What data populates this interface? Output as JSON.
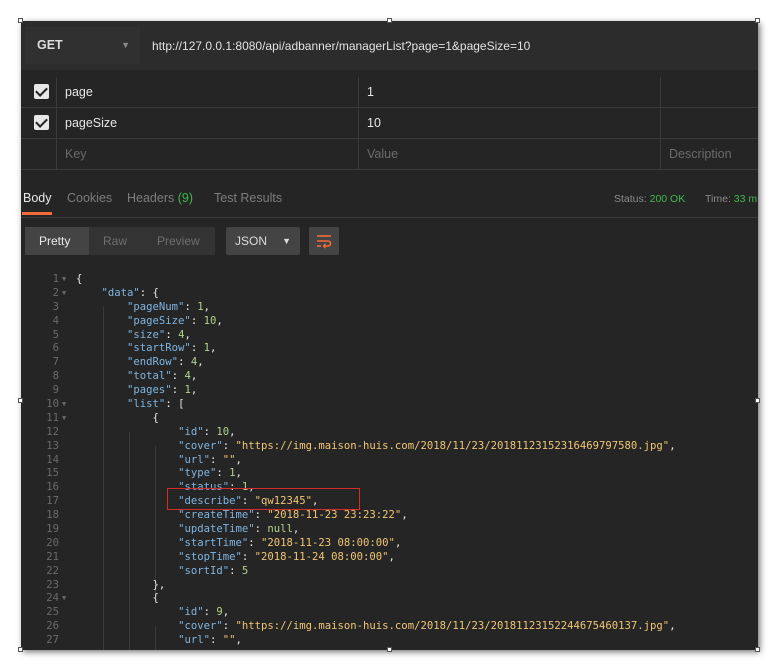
{
  "request": {
    "method": "GET",
    "url": "http://127.0.0.1:8080/api/adbanner/managerList?page=1&pageSize=10"
  },
  "params": [
    {
      "key": "page",
      "value": "1",
      "checked": true
    },
    {
      "key": "pageSize",
      "value": "10",
      "checked": true
    }
  ],
  "params_placeholder": {
    "key": "Key",
    "value": "Value",
    "description": "Description"
  },
  "response_tabs": {
    "body": "Body",
    "cookies": "Cookies",
    "headers": "Headers",
    "headers_count": "(9)",
    "tests": "Test Results"
  },
  "status": {
    "label": "Status:",
    "value": "200 OK",
    "time_label": "Time:",
    "time_value": "33 m"
  },
  "view_modes": {
    "pretty": "Pretty",
    "raw": "Raw",
    "preview": "Preview"
  },
  "format": "JSON",
  "icons": {
    "method_dropdown": "chevron-down-icon",
    "wrap": "wrap-lines-icon",
    "check": "checkmark-icon"
  },
  "colors": {
    "accent": "#f26b3a",
    "status_ok": "#3fb84b",
    "highlight_box": "#d62b2b"
  },
  "code_lines": [
    {
      "n": "1",
      "fold": "▼",
      "t": "{"
    },
    {
      "n": "2",
      "fold": "▼",
      "t": "    \"data\": {"
    },
    {
      "n": "3",
      "t": "        \"pageNum\": 1,"
    },
    {
      "n": "4",
      "t": "        \"pageSize\": 10,"
    },
    {
      "n": "5",
      "t": "        \"size\": 4,"
    },
    {
      "n": "6",
      "t": "        \"startRow\": 1,"
    },
    {
      "n": "7",
      "t": "        \"endRow\": 4,"
    },
    {
      "n": "8",
      "t": "        \"total\": 4,"
    },
    {
      "n": "9",
      "t": "        \"pages\": 1,"
    },
    {
      "n": "10",
      "fold": "▼",
      "t": "        \"list\": ["
    },
    {
      "n": "11",
      "fold": "▼",
      "t": "            {"
    },
    {
      "n": "12",
      "t": "                \"id\": 10,"
    },
    {
      "n": "13",
      "t": "                \"cover\": \"https://img.maison-huis.com/2018/11/23/20181123152316469797580.jpg\","
    },
    {
      "n": "14",
      "t": "                \"url\": \"\","
    },
    {
      "n": "15",
      "t": "                \"type\": 1,"
    },
    {
      "n": "16",
      "t": "                \"status\": 1,"
    },
    {
      "n": "17",
      "t": "                \"describe\": \"qw12345\","
    },
    {
      "n": "18",
      "t": "                \"createTime\": \"2018-11-23 23:23:22\","
    },
    {
      "n": "19",
      "t": "                \"updateTime\": null,"
    },
    {
      "n": "20",
      "t": "                \"startTime\": \"2018-11-23 08:00:00\","
    },
    {
      "n": "21",
      "t": "                \"stopTime\": \"2018-11-24 08:00:00\","
    },
    {
      "n": "22",
      "t": "                \"sortId\": 5"
    },
    {
      "n": "23",
      "t": "            },"
    },
    {
      "n": "24",
      "fold": "▼",
      "t": "            {"
    },
    {
      "n": "25",
      "t": "                \"id\": 9,"
    },
    {
      "n": "26",
      "t": "                \"cover\": \"https://img.maison-huis.com/2018/11/23/20181123152244675460137.jpg\","
    },
    {
      "n": "27",
      "t": "                \"url\": \"\","
    }
  ]
}
